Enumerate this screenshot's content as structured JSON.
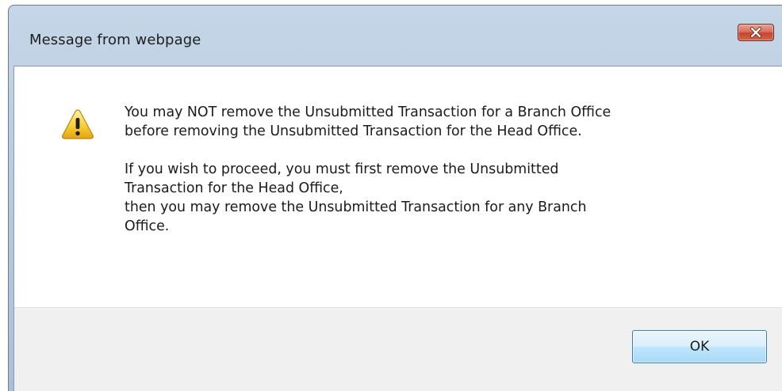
{
  "window": {
    "title": "Message from webpage"
  },
  "icons": {
    "warning": "warning-icon",
    "close": "close-icon"
  },
  "message": {
    "paragraph1_line1": "You may NOT remove the Unsubmitted Transaction for a Branch Office",
    "paragraph1_line2": "before removing the Unsubmitted Transaction for the Head Office.",
    "paragraph2_line1": "If you wish to proceed, you must first remove the Unsubmitted",
    "paragraph2_line2": "Transaction for the Head Office,",
    "paragraph3_line1": "then you may remove the Unsubmitted Transaction for any Branch",
    "paragraph3_line2": "Office."
  },
  "buttons": {
    "ok_label": "OK"
  },
  "colors": {
    "close_button": "#c7442d",
    "ok_button_border": "#3c7fb1",
    "button_bar": "#f0f0f0"
  }
}
